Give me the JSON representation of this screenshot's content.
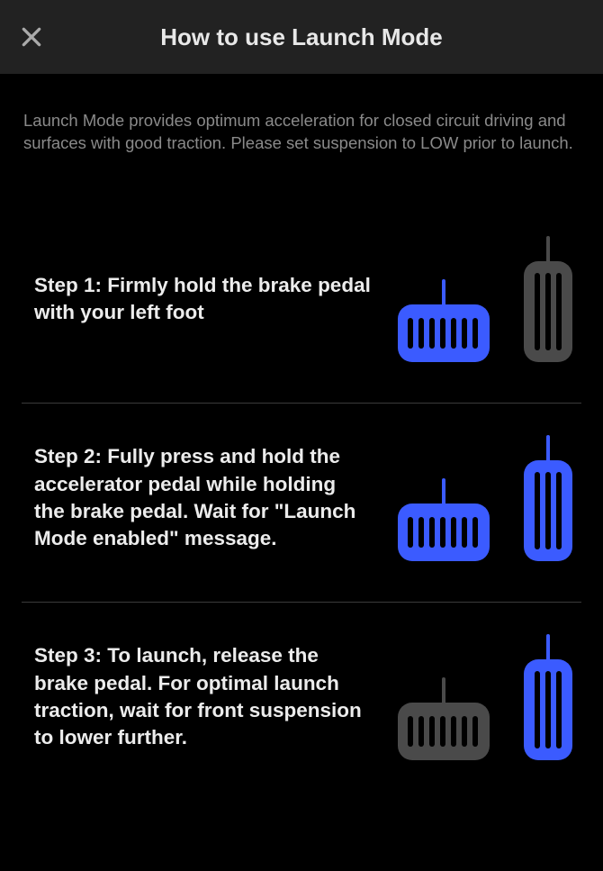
{
  "header": {
    "title": "How to use Launch Mode"
  },
  "intro": "Launch Mode provides optimum acceleration for closed circuit driving and surfaces with good traction. Please set suspension to LOW prior to launch.",
  "steps": [
    {
      "label": "Step 1: Firmly hold the brake pedal with your left foot",
      "brake_active": true,
      "accel_active": false
    },
    {
      "label": "Step 2: Fully press and hold the accelerator pedal while holding the brake pedal. Wait for \"Launch Mode enabled\" message.",
      "brake_active": true,
      "accel_active": true
    },
    {
      "label": "Step 3: To launch, release the brake pedal. For optimal launch traction, wait for front suspension to lower further.",
      "brake_active": false,
      "accel_active": true
    }
  ],
  "colors": {
    "active": "#3b5bff",
    "inactive": "#4a4a4a"
  }
}
